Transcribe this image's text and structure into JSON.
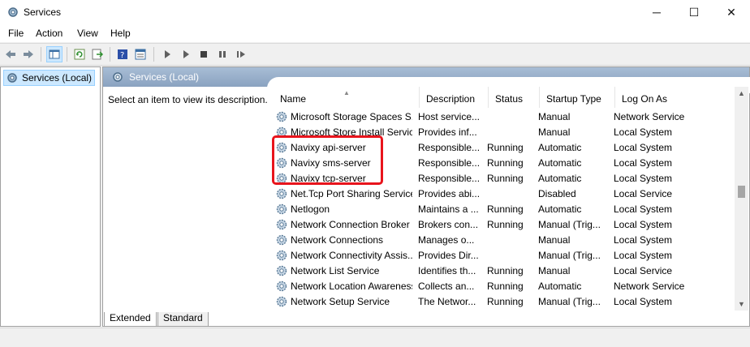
{
  "window": {
    "title": "Services",
    "icons": {
      "app": "gear-icon"
    }
  },
  "window_controls": {
    "minimize": "─",
    "maximize": "☐",
    "close": "✕"
  },
  "menu": [
    "File",
    "Action",
    "View",
    "Help"
  ],
  "toolbar": {
    "icons": [
      "back-icon",
      "forward-icon",
      "show-hide-tree-icon",
      "refresh-icon",
      "export-list-icon",
      "help-icon",
      "properties-icon",
      "start-service-icon",
      "start-service-alt-icon",
      "stop-service-icon",
      "pause-service-icon",
      "resume-service-icon"
    ]
  },
  "tree": {
    "root_label": "Services (Local)"
  },
  "pane": {
    "header_title": "Services (Local)",
    "description": "Select an item to view its description."
  },
  "columns": [
    "Name",
    "Description",
    "Status",
    "Startup Type",
    "Log On As"
  ],
  "rows": [
    {
      "name": "Microsoft Storage Spaces S...",
      "description": "Host service...",
      "status": "",
      "startup": "Manual",
      "logon": "Network Service"
    },
    {
      "name": "Microsoft Store Install Service",
      "description": "Provides inf...",
      "status": "",
      "startup": "Manual",
      "logon": "Local System"
    },
    {
      "name": "Navixy api-server",
      "description": "Responsible...",
      "status": "Running",
      "startup": "Automatic",
      "logon": "Local System"
    },
    {
      "name": "Navixy sms-server",
      "description": "Responsible...",
      "status": "Running",
      "startup": "Automatic",
      "logon": "Local System"
    },
    {
      "name": "Navixy tcp-server",
      "description": "Responsible...",
      "status": "Running",
      "startup": "Automatic",
      "logon": "Local System"
    },
    {
      "name": "Net.Tcp Port Sharing Service",
      "description": "Provides abi...",
      "status": "",
      "startup": "Disabled",
      "logon": "Local Service"
    },
    {
      "name": "Netlogon",
      "description": "Maintains a ...",
      "status": "Running",
      "startup": "Automatic",
      "logon": "Local System"
    },
    {
      "name": "Network Connection Broker",
      "description": "Brokers con...",
      "status": "Running",
      "startup": "Manual (Trig...",
      "logon": "Local System"
    },
    {
      "name": "Network Connections",
      "description": "Manages o...",
      "status": "",
      "startup": "Manual",
      "logon": "Local System"
    },
    {
      "name": "Network Connectivity Assis...",
      "description": "Provides Dir...",
      "status": "",
      "startup": "Manual (Trig...",
      "logon": "Local System"
    },
    {
      "name": "Network List Service",
      "description": "Identifies th...",
      "status": "Running",
      "startup": "Manual",
      "logon": "Local Service"
    },
    {
      "name": "Network Location Awareness",
      "description": "Collects an...",
      "status": "Running",
      "startup": "Automatic",
      "logon": "Network Service"
    },
    {
      "name": "Network Setup Service",
      "description": "The Networ...",
      "status": "Running",
      "startup": "Manual (Trig...",
      "logon": "Local System"
    }
  ],
  "tabs": [
    "Extended",
    "Standard"
  ],
  "highlight_color": "#e8141c"
}
